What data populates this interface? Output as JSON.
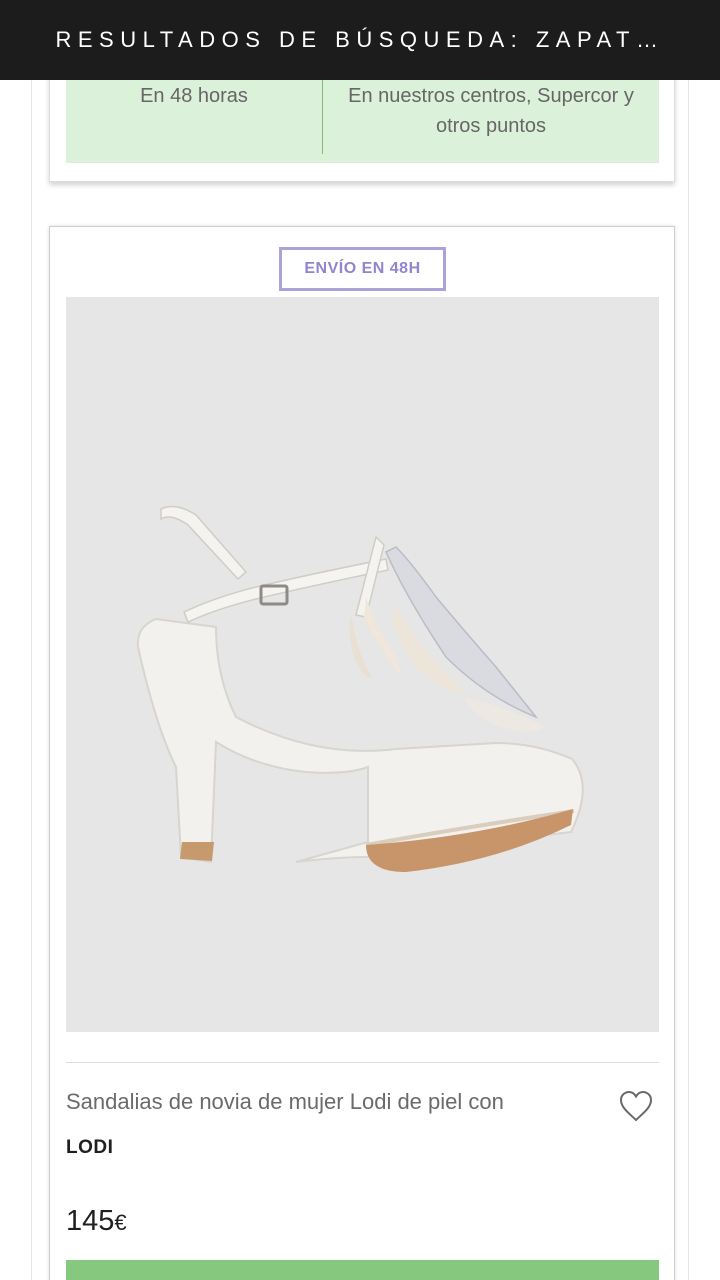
{
  "header": {
    "title": "RESULTADOS DE BÚSQUEDA: ZAPAT…"
  },
  "previous_card": {
    "delivery_left": "En 48 horas",
    "delivery_right": "En nuestros centros, Supercor y otros puntos"
  },
  "product": {
    "badge": "ENVÍO EN 48H",
    "image_label": "white-bridal-sandal-image",
    "name": "Sandalias de novia de mujer Lodi de piel con",
    "brand": "LODI",
    "price": "145",
    "currency": "€",
    "favorite_icon": "heart-outline-icon"
  },
  "colors": {
    "header_bg": "#1c1c1c",
    "delivery_bg": "#dcf1da",
    "badge_border": "#a9a2dc",
    "add_button": "#86c97e"
  }
}
